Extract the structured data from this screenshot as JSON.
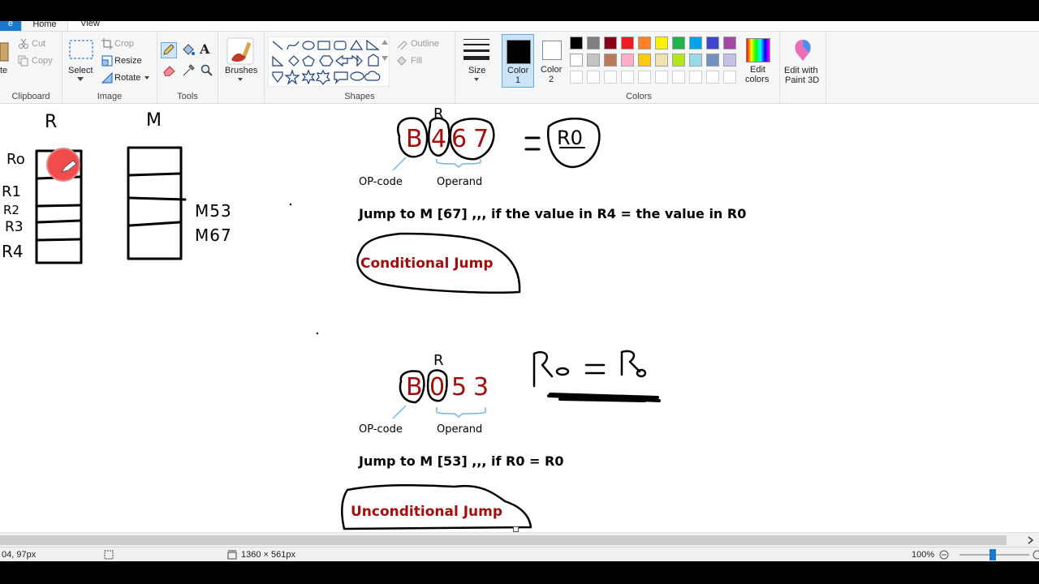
{
  "tabs": {
    "file": "e",
    "home": "Home",
    "view": "View"
  },
  "clipboard": {
    "paste": "te",
    "cut": "Cut",
    "copy": "Copy",
    "group": "Clipboard"
  },
  "image": {
    "select": "Select",
    "crop": "Crop",
    "resize": "Resize",
    "rotate": "Rotate",
    "group": "Image"
  },
  "tools": {
    "group": "Tools",
    "text_tool": "A"
  },
  "brushes": {
    "label": "Brushes"
  },
  "shapes": {
    "outline": "Outline",
    "fill": "Fill",
    "group": "Shapes"
  },
  "size": {
    "label": "Size"
  },
  "colors": {
    "color1": "Color\n1",
    "color2": "Color\n2",
    "color1_label_a": "Color",
    "color1_label_b": "1",
    "color2_label_a": "Color",
    "color2_label_b": "2",
    "edit_colors_a": "Edit",
    "edit_colors_b": "colors",
    "paint3d_a": "Edit with",
    "paint3d_b": "Paint 3D",
    "group": "Colors",
    "palette_row1": [
      "#000000",
      "#7f7f7f",
      "#880015",
      "#ed1c24",
      "#ff7f27",
      "#fff200",
      "#22b14c",
      "#00a2e8",
      "#3f48cc",
      "#a349a4"
    ],
    "palette_row2": [
      "#ffffff",
      "#c3c3c3",
      "#b97a57",
      "#ffaec9",
      "#ffc90e",
      "#efe4b0",
      "#b5e61d",
      "#99d9ea",
      "#7092be",
      "#c8bfe7"
    ],
    "palette_row3": [
      "#ffffff",
      "#ffffff",
      "#ffffff",
      "#ffffff",
      "#ffffff",
      "#ffffff",
      "#ffffff",
      "#ffffff",
      "#ffffff",
      "#ffffff"
    ]
  },
  "canvas": {
    "hw_R": "R",
    "hw_M": "M",
    "hw_R0": "Ro",
    "hw_R1": "R1",
    "hw_R2": "R2",
    "hw_R3": "R3",
    "hw_R4": "R4",
    "hw_M53": "M53",
    "hw_M67": "M67",
    "instr1": {
      "R_label": "R",
      "B": "B",
      "d4": "4",
      "d6": "6",
      "d7": "7",
      "eq": "=",
      "R0": "R0",
      "opcode": "OP-code",
      "operand": "Operand"
    },
    "jump1": "Jump to M [67] ,,, if the value in R4 = the value in R0",
    "cond": "Conditional Jump",
    "instr2": {
      "R_label": "R",
      "B": "B",
      "d0": "0",
      "d5": "5",
      "d3": "3",
      "opcode": "OP-code",
      "operand": "Operand",
      "hw_eq": "Ro = Ro"
    },
    "jump2": "Jump to M [53] ,,, if R0 = R0",
    "uncond": "Unconditional Jump"
  },
  "status": {
    "cursor": "04, 97px",
    "size": "1360 × 561px",
    "zoom": "100%"
  }
}
